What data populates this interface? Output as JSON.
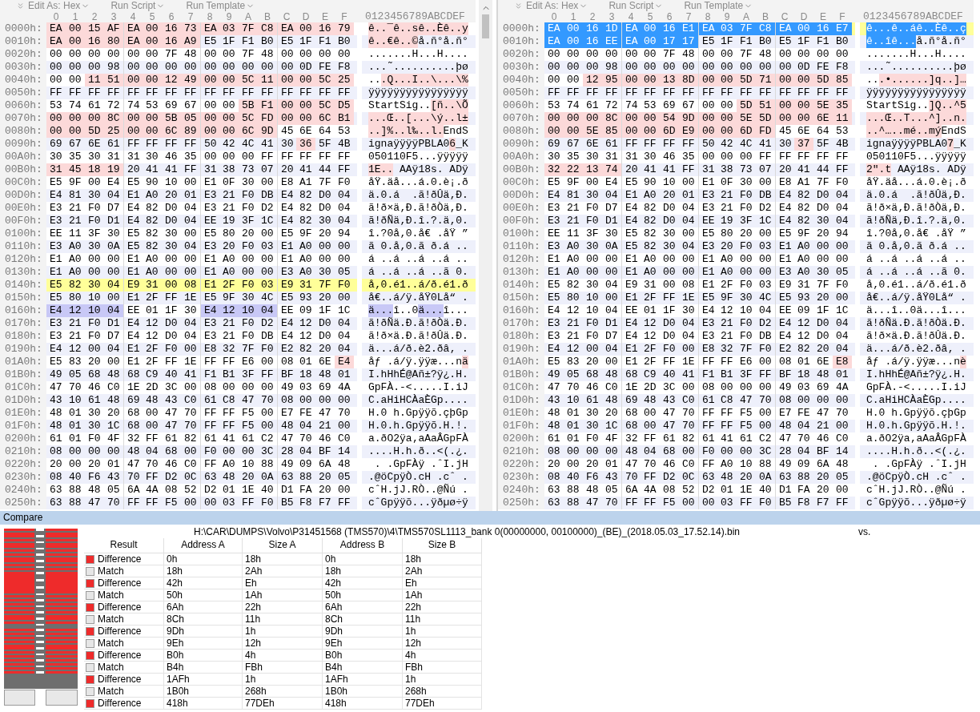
{
  "panes": [
    {
      "toolbar": [
        {
          "label": "Edit As: Hex"
        },
        {
          "label": "Run Script"
        },
        {
          "label": "Run Template"
        }
      ],
      "columns": [
        "0",
        "1",
        "2",
        "3",
        "4",
        "5",
        "6",
        "7",
        "8",
        "9",
        "A",
        "B",
        "C",
        "D",
        "E",
        "F"
      ],
      "ascii_header": "0123456789ABCDEF",
      "rows": [
        {
          "offset": "0000h:",
          "current": false,
          "segments": [
            {
              "kind": "difference",
              "hex": "EA 00 15 AF EA 00 16 73 EA 03 7F C8 EA 00 16 79",
              "ascii": "ê..¯ê..sê..Èê..y"
            }
          ]
        },
        {
          "offset": "0010h:",
          "current": false,
          "segments": [
            {
              "kind": "difference",
              "hex": "EA 00 16 80 EA 00 16 A9",
              "ascii": "ê..€ê..©"
            },
            {
              "kind": "plain",
              "hex": "E5 1F F1 B0 E5 1F F1 B0",
              "ascii": "å.ñ°å.ñ°"
            }
          ]
        },
        {
          "offset": "0020h:",
          "current": false,
          "segments": [
            {
              "kind": "plain",
              "hex": "00 00 00 00 00 00 7F 48 00 00 7F 48 00 00 00 00",
              "ascii": ".......H...H...."
            }
          ]
        },
        {
          "offset": "0030h:",
          "current": false,
          "segments": [
            {
              "kind": "plain",
              "hex": "00 00 00 98 00 00 00 00 00 00 00 00 00 0D FE F8",
              "ascii": "...˜..........þø"
            }
          ]
        },
        {
          "offset": "0040h:",
          "current": false,
          "segments": [
            {
              "kind": "plain",
              "hex": "00 00",
              "ascii": ".."
            },
            {
              "kind": "difference",
              "hex": "11 51 00 00 12 49 00 00 5C 11 00 00 5C 25",
              "ascii": ".Q...I..\\...\\%"
            }
          ]
        },
        {
          "offset": "0050h:",
          "current": false,
          "segments": [
            {
              "kind": "plain",
              "hex": "FF FF FF FF FF FF FF FF FF FF FF FF FF FF FF FF",
              "ascii": "ÿÿÿÿÿÿÿÿÿÿÿÿÿÿÿÿ"
            }
          ]
        },
        {
          "offset": "0060h:",
          "current": false,
          "segments": [
            {
              "kind": "plain",
              "hex": "53 74 61 72 74 53 69 67 00 00",
              "ascii": "StartSig.."
            },
            {
              "kind": "difference",
              "hex": "5B F1 00 00 5C D5",
              "ascii": "[ñ..\\Õ"
            }
          ]
        },
        {
          "offset": "0070h:",
          "current": false,
          "segments": [
            {
              "kind": "difference",
              "hex": "00 00 00 8C 00 00 5B 05 00 00 5C FD 00 00 6C B1",
              "ascii": "...Œ..[...\\ý..l±"
            }
          ]
        },
        {
          "offset": "0080h:",
          "current": false,
          "segments": [
            {
              "kind": "difference",
              "hex": "00 00 5D 25 00 00 6C 89 00 00 6C 9D",
              "ascii": "..]%..l‰..l."
            },
            {
              "kind": "plain",
              "hex": "45 6E 64 53",
              "ascii": "EndS"
            }
          ]
        },
        {
          "offset": "0090h:",
          "current": false,
          "segments": [
            {
              "kind": "plain",
              "hex": "69 67 6E 61 FF FF FF FF 50 42 4C 41 30",
              "ascii": "ignaÿÿÿÿPBLA0"
            },
            {
              "kind": "difference",
              "hex": "36",
              "ascii": "6"
            },
            {
              "kind": "plain",
              "hex": "5F 4B",
              "ascii": "_K"
            }
          ]
        },
        {
          "offset": "00A0h:",
          "current": false,
          "segments": [
            {
              "kind": "plain",
              "hex": "30 35 30 31 31 30 46 35 00 00 00 FF FF FF FF FF",
              "ascii": "050110F5...ÿÿÿÿÿ"
            }
          ]
        },
        {
          "offset": "00B0h:",
          "current": false,
          "segments": [
            {
              "kind": "difference",
              "hex": "31 45 18 19",
              "ascii": "1E.."
            },
            {
              "kind": "plain",
              "hex": "20 41 41 FF 31 38 73 07 20 41 44 FF",
              "ascii": " AAÿ18s. ADÿ"
            }
          ]
        },
        {
          "offset": "00C0h:",
          "current": false,
          "segments": [
            {
              "kind": "plain",
              "hex": "E5 9F 00 E4 E5 90 10 00 E1 0F 30 00 E8 A1 7F F0",
              "ascii": "åŸ.äå...á.0.è¡.ð"
            }
          ]
        },
        {
          "offset": "00D0h:",
          "current": false,
          "segments": [
            {
              "kind": "plain",
              "hex": "E4 81 30 04 E1 A0 20 01 E3 21 F0 DB E4 82 D0 04",
              "ascii": "ä.0.á  .ã!ðÛä‚Ð."
            }
          ]
        },
        {
          "offset": "00E0h:",
          "current": false,
          "segments": [
            {
              "kind": "plain",
              "hex": "E3 21 F0 D7 E4 82 D0 04 E3 21 F0 D2 E4 82 D0 04",
              "ascii": "ã!ð×ä‚Ð.ã!ðÒä‚Ð."
            }
          ]
        },
        {
          "offset": "00F0h:",
          "current": false,
          "segments": [
            {
              "kind": "plain",
              "hex": "E3 21 F0 D1 E4 82 D0 04 EE 19 3F 1C E4 82 30 04",
              "ascii": "ã!ðÑä‚Ð.î.?.ä‚0."
            }
          ]
        },
        {
          "offset": "0100h:",
          "current": false,
          "segments": [
            {
              "kind": "plain",
              "hex": "EE 11 3F 30 E5 82 30 00 E5 80 20 00 E5 9F 20 94",
              "ascii": "î.?0å‚0.å€ .åŸ ”"
            }
          ]
        },
        {
          "offset": "0110h:",
          "current": false,
          "segments": [
            {
              "kind": "plain",
              "hex": "E3 A0 30 0A E5 82 30 04 E3 20 F0 03 E1 A0 00 00",
              "ascii": "ã 0.å‚0.ã ð.á .."
            }
          ]
        },
        {
          "offset": "0120h:",
          "current": false,
          "segments": [
            {
              "kind": "plain",
              "hex": "E1 A0 00 00 E1 A0 00 00 E1 A0 00 00 E1 A0 00 00",
              "ascii": "á ..á ..á ..á .."
            }
          ]
        },
        {
          "offset": "0130h:",
          "current": false,
          "segments": [
            {
              "kind": "plain",
              "hex": "E1 A0 00 00 E1 A0 00 00 E1 A0 00 00 E3 A0 30 05",
              "ascii": "á ..á ..á ..ã 0."
            }
          ]
        },
        {
          "offset": "0140h:",
          "current": true,
          "segments": [
            {
              "kind": "plain",
              "hex": "E5 82 30 04 E9 31 00 08 E1 2F F0 03 E9 31 7F F0",
              "ascii": "å‚0.é1..á/ð.é1.ð"
            }
          ]
        },
        {
          "offset": "0150h:",
          "current": false,
          "segments": [
            {
              "kind": "plain",
              "hex": "E5 80 10 00 E1 2F FF 1E E5 9F 30 4C E5 93 20 00",
              "ascii": "å€..á/ÿ.åŸ0Lå“ ."
            }
          ]
        },
        {
          "offset": "0160h:",
          "current": false,
          "segments": [
            {
              "kind": "found",
              "hex": "E4 12 10 04",
              "ascii": "ä..."
            },
            {
              "kind": "plain",
              "hex": "EE 01 1F 30",
              "ascii": "î..0"
            },
            {
              "kind": "found",
              "hex": "E4 12 10 04",
              "ascii": "ä..."
            },
            {
              "kind": "plain",
              "hex": "EE 09 1F 1C",
              "ascii": "î..."
            }
          ]
        },
        {
          "offset": "0170h:",
          "current": false,
          "segments": [
            {
              "kind": "plain",
              "hex": "E3 21 F0 D1 E4 12 D0 04 E3 21 F0 D2 E4 12 D0 04",
              "ascii": "ã!ðÑä.Ð.ã!ðÒä.Ð."
            }
          ]
        },
        {
          "offset": "0180h:",
          "current": false,
          "segments": [
            {
              "kind": "plain",
              "hex": "E3 21 F0 D7 E4 12 D0 04 E3 21 F0 DB E4 12 D0 04",
              "ascii": "ã!ð×ä.Ð.ã!ðÛä.Ð."
            }
          ]
        },
        {
          "offset": "0190h:",
          "current": false,
          "segments": [
            {
              "kind": "plain",
              "hex": "E4 12 00 04 E1 2F F0 00 E8 32 7F F0 E2 82 20 04",
              "ascii": "ä...á/ð.è2.ðâ‚ ."
            }
          ]
        },
        {
          "offset": "01A0h:",
          "current": false,
          "segments": [
            {
              "kind": "plain",
              "hex": "E5 83 20 00 E1 2F FF 1E FF FF E6 00 08 01 6E",
              "ascii": "åƒ .á/ÿ.ÿÿæ...n"
            },
            {
              "kind": "difference",
              "hex": "E4",
              "ascii": "ä"
            }
          ]
        },
        {
          "offset": "01B0h:",
          "current": false,
          "segments": [
            {
              "kind": "plain",
              "hex": "49 05 68 48 68 C9 40 41 F1 B1 3F FF BF 18 48 01",
              "ascii": "I.hHhÉ@Añ±?ÿ¿.H."
            }
          ]
        },
        {
          "offset": "01C0h:",
          "current": false,
          "segments": [
            {
              "kind": "plain",
              "hex": "47 70 46 C0 1E 2D 3C 00 08 00 00 00 49 03 69 4A",
              "ascii": "GpFÀ.-<.....I.iJ"
            }
          ]
        },
        {
          "offset": "01D0h:",
          "current": false,
          "segments": [
            {
              "kind": "plain",
              "hex": "43 10 61 48 69 48 43 C0 61 C8 47 70 08 00 00 00",
              "ascii": "C.aHiHCÀaÈGp...."
            }
          ]
        },
        {
          "offset": "01E0h:",
          "current": false,
          "segments": [
            {
              "kind": "plain",
              "hex": "48 01 30 20 68 00 47 70 FF FF F5 00 E7 FE 47 70",
              "ascii": "H.0 h.Gpÿÿõ.çþGp"
            }
          ]
        },
        {
          "offset": "01F0h:",
          "current": false,
          "segments": [
            {
              "kind": "plain",
              "hex": "48 01 30 1C 68 00 47 70 FF FF F5 00 48 04 21 00",
              "ascii": "H.0.h.Gpÿÿõ.H.!."
            }
          ]
        },
        {
          "offset": "0200h:",
          "current": false,
          "segments": [
            {
              "kind": "plain",
              "hex": "61 01 F0 4F 32 FF 61 82 61 41 61 C2 47 70 46 C0",
              "ascii": "a.ðO2ÿa‚aAaÂGpFÀ"
            }
          ]
        },
        {
          "offset": "0210h:",
          "current": false,
          "segments": [
            {
              "kind": "plain",
              "hex": "08 00 00 00 48 04 68 00 F0 00 00 3C 28 04 BF 14",
              "ascii": "....H.h.ð..<(.¿."
            }
          ]
        },
        {
          "offset": "0220h:",
          "current": false,
          "segments": [
            {
              "kind": "plain",
              "hex": "20 00 20 01 47 70 46 C0 FF A0 10 88 49 09 6A 48",
              "ascii": " . .GpFÀÿ .ˆI.jH"
            }
          ]
        },
        {
          "offset": "0230h:",
          "current": false,
          "segments": [
            {
              "kind": "plain",
              "hex": "08 40 F6 43 70 FF D2 0C 63 48 20 0A 63 88 20 05",
              "ascii": ".@öCpÿÒ.cH .cˆ ."
            }
          ]
        },
        {
          "offset": "0240h:",
          "current": false,
          "segments": [
            {
              "kind": "plain",
              "hex": "63 88 48 05 6A 4A 08 52 D2 01 1E 40 D1 FA 20 00",
              "ascii": "cˆH.jJ.RÒ..@Ñú ."
            }
          ]
        },
        {
          "offset": "0250h:",
          "current": false,
          "segments": [
            {
              "kind": "plain",
              "hex": "63 88 47 70 FF FF F5 00 00 03 FF F0 B5 F8 F7 FF",
              "ascii": "cˆGpÿÿõ...ÿðµø÷ÿ"
            }
          ]
        }
      ]
    },
    {
      "toolbar": [
        {
          "label": "Edit As: Hex"
        },
        {
          "label": "Run Script"
        },
        {
          "label": "Run Template"
        }
      ],
      "columns": [
        "0",
        "1",
        "2",
        "3",
        "4",
        "5",
        "6",
        "7",
        "8",
        "9",
        "A",
        "B",
        "C",
        "D",
        "E",
        "F"
      ],
      "ascii_header": "0123456789ABCDEF",
      "rows": [
        {
          "offset": "0000h:",
          "current": true,
          "segments": [
            {
              "kind": "selected",
              "hex": "EA 00 16 1D EA 00 16 E1 EA 03 7F C8 EA 00 16 E7",
              "ascii": "ê...ê..áê..Èê..ç"
            }
          ]
        },
        {
          "offset": "0010h:",
          "current": false,
          "segments": [
            {
              "kind": "selected",
              "hex": "EA 00 16 EE EA 00 17 17",
              "ascii": "ê..îê..."
            },
            {
              "kind": "plain",
              "hex": "E5 1F F1 B0 E5 1F F1 B0",
              "ascii": "å.ñ°å.ñ°"
            }
          ]
        },
        {
          "offset": "0020h:",
          "current": false,
          "segments": [
            {
              "kind": "plain",
              "hex": "00 00 00 00 00 00 7F 48 00 00 7F 48 00 00 00 00",
              "ascii": ".......H...H...."
            }
          ]
        },
        {
          "offset": "0030h:",
          "current": false,
          "segments": [
            {
              "kind": "plain",
              "hex": "00 00 00 98 00 00 00 00 00 00 00 00 00 0D FE F8",
              "ascii": "...˜..........þø"
            }
          ]
        },
        {
          "offset": "0040h:",
          "current": false,
          "segments": [
            {
              "kind": "plain",
              "hex": "00 00",
              "ascii": ".."
            },
            {
              "kind": "difference",
              "hex": "12 95 00 00 13 8D 00 00 5D 71 00 00 5D 85",
              "ascii": ".•......]q..]…"
            }
          ]
        },
        {
          "offset": "0050h:",
          "current": false,
          "segments": [
            {
              "kind": "plain",
              "hex": "FF FF FF FF FF FF FF FF FF FF FF FF FF FF FF FF",
              "ascii": "ÿÿÿÿÿÿÿÿÿÿÿÿÿÿÿÿ"
            }
          ]
        },
        {
          "offset": "0060h:",
          "current": false,
          "segments": [
            {
              "kind": "plain",
              "hex": "53 74 61 72 74 53 69 67 00 00",
              "ascii": "StartSig.."
            },
            {
              "kind": "difference",
              "hex": "5D 51 00 00 5E 35",
              "ascii": "]Q..^5"
            }
          ]
        },
        {
          "offset": "0070h:",
          "current": false,
          "segments": [
            {
              "kind": "difference",
              "hex": "00 00 00 8C 00 00 54 9D 00 00 5E 5D 00 00 6E 11",
              "ascii": "...Œ..T...^]..n."
            }
          ]
        },
        {
          "offset": "0080h:",
          "current": false,
          "segments": [
            {
              "kind": "difference",
              "hex": "00 00 5E 85 00 00 6D E9 00 00 6D FD",
              "ascii": "..^…..mé..mý"
            },
            {
              "kind": "plain",
              "hex": "45 6E 64 53",
              "ascii": "EndS"
            }
          ]
        },
        {
          "offset": "0090h:",
          "current": false,
          "segments": [
            {
              "kind": "plain",
              "hex": "69 67 6E 61 FF FF FF FF 50 42 4C 41 30",
              "ascii": "ignaÿÿÿÿPBLA0"
            },
            {
              "kind": "difference",
              "hex": "37",
              "ascii": "7"
            },
            {
              "kind": "plain",
              "hex": "5F 4B",
              "ascii": "_K"
            }
          ]
        },
        {
          "offset": "00A0h:",
          "current": false,
          "segments": [
            {
              "kind": "plain",
              "hex": "30 35 30 31 31 30 46 35 00 00 00 FF FF FF FF FF",
              "ascii": "050110F5...ÿÿÿÿÿ"
            }
          ]
        },
        {
          "offset": "00B0h:",
          "current": false,
          "segments": [
            {
              "kind": "difference",
              "hex": "32 22 13 74",
              "ascii": "2\".t"
            },
            {
              "kind": "plain",
              "hex": "20 41 41 FF 31 38 73 07 20 41 44 FF",
              "ascii": " AAÿ18s. ADÿ"
            }
          ]
        },
        {
          "offset": "00C0h:",
          "current": false,
          "segments": [
            {
              "kind": "plain",
              "hex": "E5 9F 00 E4 E5 90 10 00 E1 0F 30 00 E8 A1 7F F0",
              "ascii": "åŸ.äå...á.0.è¡.ð"
            }
          ]
        },
        {
          "offset": "00D0h:",
          "current": false,
          "segments": [
            {
              "kind": "plain",
              "hex": "E4 81 30 04 E1 A0 20 01 E3 21 F0 DB E4 82 D0 04",
              "ascii": "ä.0.á  .ã!ðÛä‚Ð."
            }
          ]
        },
        {
          "offset": "00E0h:",
          "current": false,
          "segments": [
            {
              "kind": "plain",
              "hex": "E3 21 F0 D7 E4 82 D0 04 E3 21 F0 D2 E4 82 D0 04",
              "ascii": "ã!ð×ä‚Ð.ã!ðÒä‚Ð."
            }
          ]
        },
        {
          "offset": "00F0h:",
          "current": false,
          "segments": [
            {
              "kind": "plain",
              "hex": "E3 21 F0 D1 E4 82 D0 04 EE 19 3F 1C E4 82 30 04",
              "ascii": "ã!ðÑä‚Ð.î.?.ä‚0."
            }
          ]
        },
        {
          "offset": "0100h:",
          "current": false,
          "segments": [
            {
              "kind": "plain",
              "hex": "EE 11 3F 30 E5 82 30 00 E5 80 20 00 E5 9F 20 94",
              "ascii": "î.?0å‚0.å€ .åŸ ”"
            }
          ]
        },
        {
          "offset": "0110h:",
          "current": false,
          "segments": [
            {
              "kind": "plain",
              "hex": "E3 A0 30 0A E5 82 30 04 E3 20 F0 03 E1 A0 00 00",
              "ascii": "ã 0.å‚0.ã ð.á .."
            }
          ]
        },
        {
          "offset": "0120h:",
          "current": false,
          "segments": [
            {
              "kind": "plain",
              "hex": "E1 A0 00 00 E1 A0 00 00 E1 A0 00 00 E1 A0 00 00",
              "ascii": "á ..á ..á ..á .."
            }
          ]
        },
        {
          "offset": "0130h:",
          "current": false,
          "segments": [
            {
              "kind": "plain",
              "hex": "E1 A0 00 00 E1 A0 00 00 E1 A0 00 00 E3 A0 30 05",
              "ascii": "á ..á ..á ..ã 0."
            }
          ]
        },
        {
          "offset": "0140h:",
          "current": false,
          "segments": [
            {
              "kind": "plain",
              "hex": "E5 82 30 04 E9 31 00 08 E1 2F F0 03 E9 31 7F F0",
              "ascii": "å‚0.é1..á/ð.é1.ð"
            }
          ]
        },
        {
          "offset": "0150h:",
          "current": false,
          "segments": [
            {
              "kind": "plain",
              "hex": "E5 80 10 00 E1 2F FF 1E E5 9F 30 4C E5 93 20 00",
              "ascii": "å€..á/ÿ.åŸ0Lå“ ."
            }
          ]
        },
        {
          "offset": "0160h:",
          "current": false,
          "segments": [
            {
              "kind": "plain",
              "hex": "E4 12 10 04 EE 01 1F 30 E4 12 10 04 EE 09 1F 1C",
              "ascii": "ä...î..0ä...î..."
            }
          ]
        },
        {
          "offset": "0170h:",
          "current": false,
          "segments": [
            {
              "kind": "plain",
              "hex": "E3 21 F0 D1 E4 12 D0 04 E3 21 F0 D2 E4 12 D0 04",
              "ascii": "ã!ðÑä.Ð.ã!ðÒä.Ð."
            }
          ]
        },
        {
          "offset": "0180h:",
          "current": false,
          "segments": [
            {
              "kind": "plain",
              "hex": "E3 21 F0 D7 E4 12 D0 04 E3 21 F0 DB E4 12 D0 04",
              "ascii": "ã!ð×ä.Ð.ã!ðÛä.Ð."
            }
          ]
        },
        {
          "offset": "0190h:",
          "current": false,
          "segments": [
            {
              "kind": "plain",
              "hex": "E4 12 00 04 E1 2F F0 00 E8 32 7F F0 E2 82 20 04",
              "ascii": "ä...á/ð.è2.ðâ‚ ."
            }
          ]
        },
        {
          "offset": "01A0h:",
          "current": false,
          "segments": [
            {
              "kind": "plain",
              "hex": "E5 83 20 00 E1 2F FF 1E FF FF E6 00 08 01 6E",
              "ascii": "åƒ .á/ÿ.ÿÿæ...n"
            },
            {
              "kind": "difference",
              "hex": "E8",
              "ascii": "è"
            }
          ]
        },
        {
          "offset": "01B0h:",
          "current": false,
          "segments": [
            {
              "kind": "plain",
              "hex": "49 05 68 48 68 C9 40 41 F1 B1 3F FF BF 18 48 01",
              "ascii": "I.hHhÉ@Añ±?ÿ¿.H."
            }
          ]
        },
        {
          "offset": "01C0h:",
          "current": false,
          "segments": [
            {
              "kind": "plain",
              "hex": "47 70 46 C0 1E 2D 3C 00 08 00 00 00 49 03 69 4A",
              "ascii": "GpFÀ.-<.....I.iJ"
            }
          ]
        },
        {
          "offset": "01D0h:",
          "current": false,
          "segments": [
            {
              "kind": "plain",
              "hex": "43 10 61 48 69 48 43 C0 61 C8 47 70 08 00 00 00",
              "ascii": "C.aHiHCÀaÈGp...."
            }
          ]
        },
        {
          "offset": "01E0h:",
          "current": false,
          "segments": [
            {
              "kind": "plain",
              "hex": "48 01 30 20 68 00 47 70 FF FF F5 00 E7 FE 47 70",
              "ascii": "H.0 h.Gpÿÿõ.çþGp"
            }
          ]
        },
        {
          "offset": "01F0h:",
          "current": false,
          "segments": [
            {
              "kind": "plain",
              "hex": "48 01 30 1C 68 00 47 70 FF FF F5 00 48 04 21 00",
              "ascii": "H.0.h.Gpÿÿõ.H.!."
            }
          ]
        },
        {
          "offset": "0200h:",
          "current": false,
          "segments": [
            {
              "kind": "plain",
              "hex": "61 01 F0 4F 32 FF 61 82 61 41 61 C2 47 70 46 C0",
              "ascii": "a.ðO2ÿa‚aAaÂGpFÀ"
            }
          ]
        },
        {
          "offset": "0210h:",
          "current": false,
          "segments": [
            {
              "kind": "plain",
              "hex": "08 00 00 00 48 04 68 00 F0 00 00 3C 28 04 BF 14",
              "ascii": "....H.h.ð..<(.¿."
            }
          ]
        },
        {
          "offset": "0220h:",
          "current": false,
          "segments": [
            {
              "kind": "plain",
              "hex": "20 00 20 01 47 70 46 C0 FF A0 10 88 49 09 6A 48",
              "ascii": " . .GpFÀÿ .ˆI.jH"
            }
          ]
        },
        {
          "offset": "0230h:",
          "current": false,
          "segments": [
            {
              "kind": "plain",
              "hex": "08 40 F6 43 70 FF D2 0C 63 48 20 0A 63 88 20 05",
              "ascii": ".@öCpÿÒ.cH .cˆ ."
            }
          ]
        },
        {
          "offset": "0240h:",
          "current": false,
          "segments": [
            {
              "kind": "plain",
              "hex": "63 88 48 05 6A 4A 08 52 D2 01 1E 40 D1 FA 20 00",
              "ascii": "cˆH.jJ.RÒ..@Ñú ."
            }
          ]
        },
        {
          "offset": "0250h:",
          "current": false,
          "segments": [
            {
              "kind": "plain",
              "hex": "63 88 47 70 FF FF F5 00 00 03 FF F0 B5 F8 F7 FF",
              "ascii": "cˆGpÿÿõ...ÿðµø÷ÿ"
            }
          ]
        }
      ]
    }
  ],
  "compare": {
    "title": "Compare",
    "file_a": "H:\\CAR\\DUMPS\\Volvo\\P31451568 (TMS570)\\4\\TMS570SL1113_bank 0(00000000, 00100000)_(BE)_(2018.05.03_17.52.14).bin",
    "versus": "vs.",
    "columns": [
      "Result",
      "Address A",
      "Size A",
      "Address B",
      "Size B"
    ],
    "rows": [
      {
        "result": "Difference",
        "color": "#ee2b2b",
        "address_a": "0h",
        "size_a": "18h",
        "address_b": "0h",
        "size_b": "18h"
      },
      {
        "result": "Match",
        "color": "#e6e6e6",
        "address_a": "18h",
        "size_a": "2Ah",
        "address_b": "18h",
        "size_b": "2Ah"
      },
      {
        "result": "Difference",
        "color": "#ee2b2b",
        "address_a": "42h",
        "size_a": "Eh",
        "address_b": "42h",
        "size_b": "Eh"
      },
      {
        "result": "Match",
        "color": "#e6e6e6",
        "address_a": "50h",
        "size_a": "1Ah",
        "address_b": "50h",
        "size_b": "1Ah"
      },
      {
        "result": "Difference",
        "color": "#ee2b2b",
        "address_a": "6Ah",
        "size_a": "22h",
        "address_b": "6Ah",
        "size_b": "22h"
      },
      {
        "result": "Match",
        "color": "#e6e6e6",
        "address_a": "8Ch",
        "size_a": "11h",
        "address_b": "8Ch",
        "size_b": "11h"
      },
      {
        "result": "Difference",
        "color": "#ee2b2b",
        "address_a": "9Dh",
        "size_a": "1h",
        "address_b": "9Dh",
        "size_b": "1h"
      },
      {
        "result": "Match",
        "color": "#e6e6e6",
        "address_a": "9Eh",
        "size_a": "12h",
        "address_b": "9Eh",
        "size_b": "12h"
      },
      {
        "result": "Difference",
        "color": "#ee2b2b",
        "address_a": "B0h",
        "size_a": "4h",
        "address_b": "B0h",
        "size_b": "4h"
      },
      {
        "result": "Match",
        "color": "#e6e6e6",
        "address_a": "B4h",
        "size_a": "FBh",
        "address_b": "B4h",
        "size_b": "FBh"
      },
      {
        "result": "Difference",
        "color": "#ee2b2b",
        "address_a": "1AFh",
        "size_a": "1h",
        "address_b": "1AFh",
        "size_b": "1h"
      },
      {
        "result": "Match",
        "color": "#e6e6e6",
        "address_a": "1B0h",
        "size_a": "268h",
        "address_b": "1B0h",
        "size_b": "268h"
      },
      {
        "result": "Difference",
        "color": "#ee2b2b",
        "address_a": "418h",
        "size_a": "77DEh",
        "address_b": "418h",
        "size_b": "77DEh"
      }
    ]
  }
}
